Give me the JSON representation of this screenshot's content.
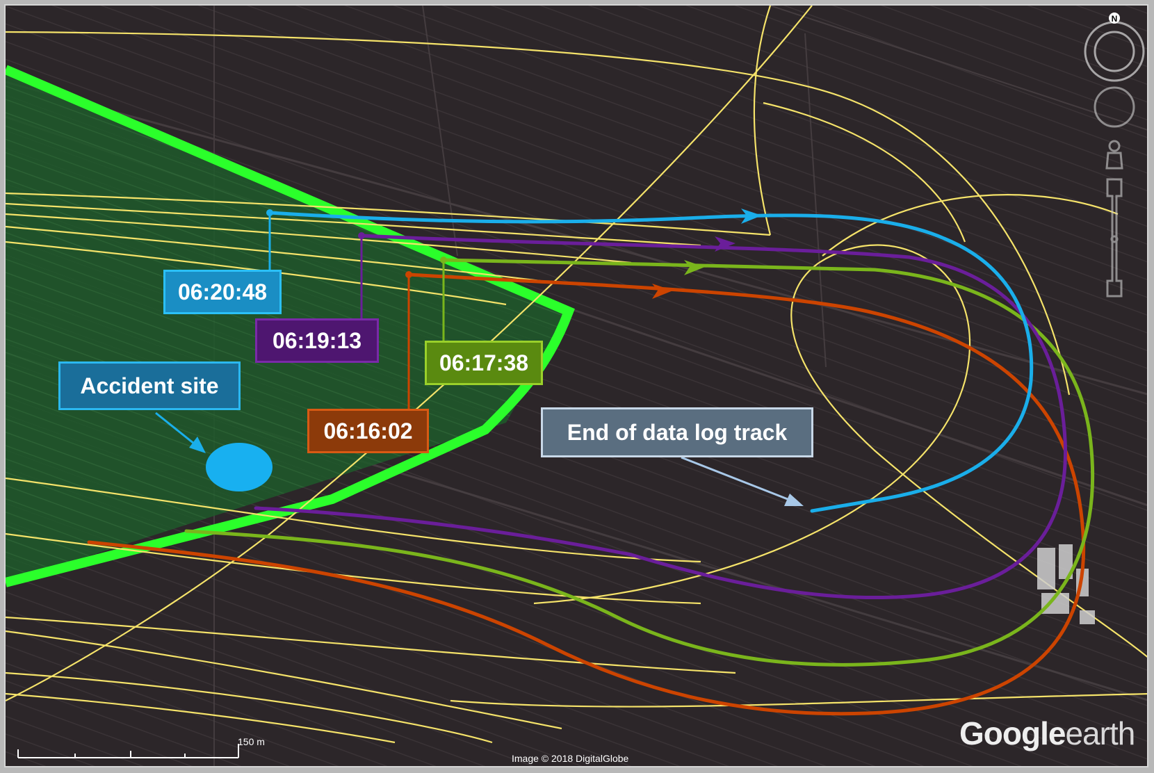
{
  "labels": {
    "t0620": "06:20:48",
    "t0619": "06:19:13",
    "t0617": "06:17:38",
    "t0616": "06:16:02",
    "accident": "Accident site",
    "end": "End of data log track"
  },
  "imagery_credit": "Image © 2018 DigitalGlobe",
  "scale_bar": {
    "label": "150 m"
  },
  "logo": {
    "google": "Google",
    "earth": "earth"
  },
  "compass": {
    "north": "N"
  },
  "colors": {
    "track_0620": "#1aaeea",
    "track_0619": "#6a1e9a",
    "track_0617": "#7ab51c",
    "track_0616": "#cc4400",
    "boundary": "#2bff2b",
    "grid_lines": "#f5e36a",
    "accident_site": "#18b0f0"
  },
  "icons": [
    "compass-ring-icon",
    "look-joystick-icon",
    "street-view-pegman-icon",
    "zoom-slider-icon"
  ]
}
